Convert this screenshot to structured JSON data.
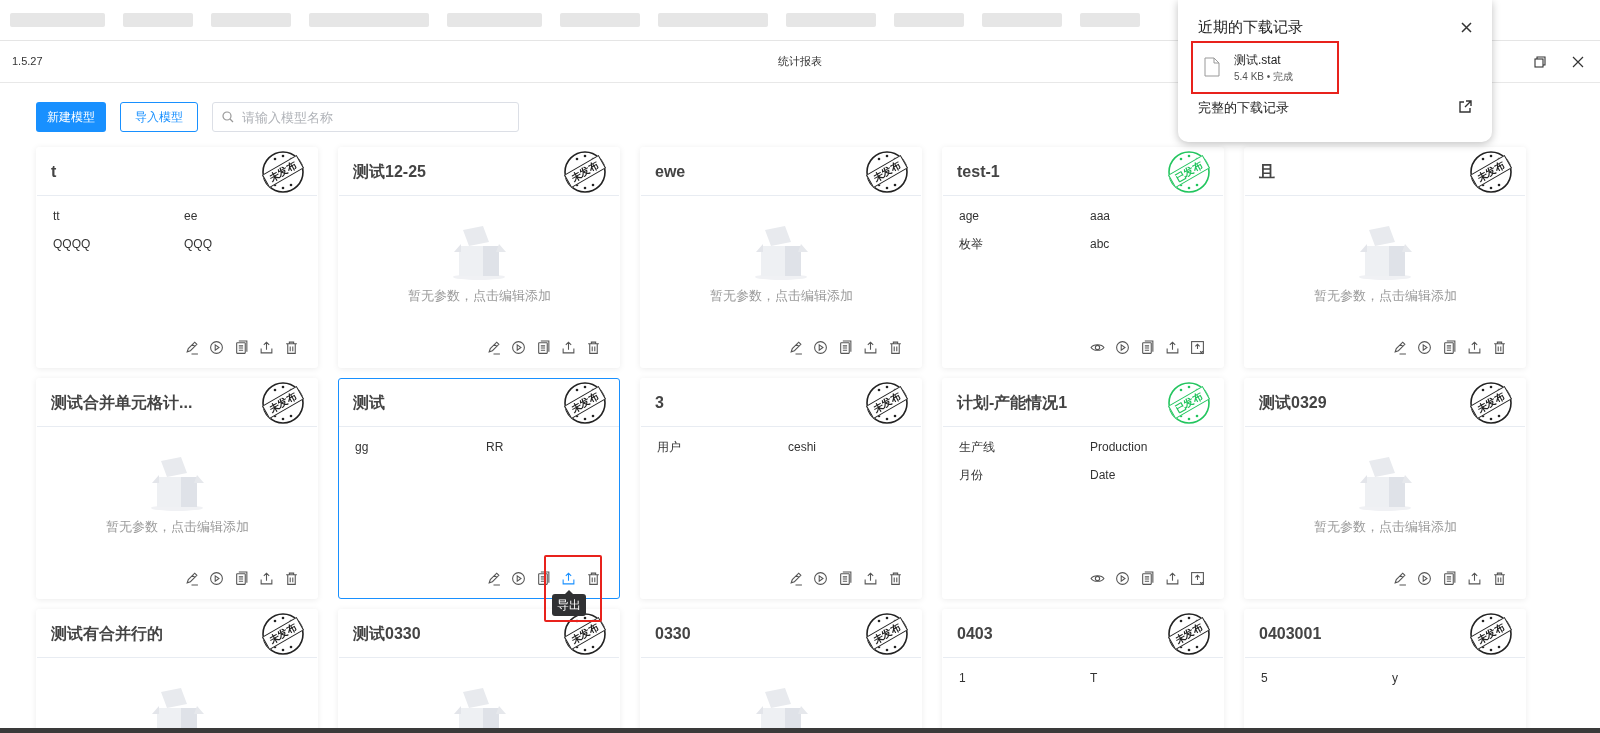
{
  "window": {
    "version": "1.5.27",
    "title": "统计报表"
  },
  "toolbar": {
    "buttons": [
      {
        "label": "新建模型",
        "kind": "primary"
      },
      {
        "label": "导入模型",
        "kind": "outline"
      }
    ],
    "search": {
      "placeholder": "请输入模型名称"
    }
  },
  "cards": [
    {
      "title": "t",
      "stamp": "未发布",
      "published": false,
      "selected": false,
      "params": [
        [
          "tt",
          "ee"
        ],
        [
          "QQQQ",
          "QQQ"
        ]
      ]
    },
    {
      "title": "测试12-25",
      "stamp": "未发布",
      "published": false,
      "selected": false,
      "empty_text": "暂无参数，点击编辑添加"
    },
    {
      "title": "ewe",
      "stamp": "未发布",
      "published": false,
      "selected": false,
      "empty_text": "暂无参数，点击编辑添加"
    },
    {
      "title": "test-1",
      "stamp": "已发布",
      "published": true,
      "selected": false,
      "params": [
        [
          "age",
          "aaa"
        ],
        [
          "枚举",
          "abc"
        ]
      ]
    },
    {
      "title": "且",
      "stamp": "未发布",
      "published": false,
      "selected": false,
      "empty_text": "暂无参数，点击编辑添加"
    },
    {
      "title": "测试合并单元格计...",
      "stamp": "未发布",
      "published": false,
      "selected": false,
      "empty_text": "暂无参数，点击编辑添加"
    },
    {
      "title": "测试",
      "stamp": "未发布",
      "published": false,
      "selected": true,
      "params": [
        [
          "gg",
          "RR"
        ]
      ],
      "tooltip": "导出"
    },
    {
      "title": "3",
      "stamp": "未发布",
      "published": false,
      "selected": false,
      "params": [
        [
          "用户",
          "ceshi"
        ]
      ]
    },
    {
      "title": "计划-产能情况1",
      "stamp": "已发布",
      "published": true,
      "selected": false,
      "params": [
        [
          "生产线",
          "Production"
        ],
        [
          "月份",
          "Date"
        ]
      ]
    },
    {
      "title": "测试0329",
      "stamp": "未发布",
      "published": false,
      "selected": false,
      "empty_text": "暂无参数，点击编辑添加"
    },
    {
      "title": "测试有合并行的",
      "stamp": "未发布",
      "published": false,
      "selected": false
    },
    {
      "title": "测试0330",
      "stamp": "未发布",
      "published": false,
      "selected": false
    },
    {
      "title": "0330",
      "stamp": "未发布",
      "published": false,
      "selected": false
    },
    {
      "title": "0403",
      "stamp": "未发布",
      "published": false,
      "selected": false,
      "params": [
        [
          "1",
          "T"
        ]
      ]
    },
    {
      "title": "0403001",
      "stamp": "未发布",
      "published": false,
      "selected": false,
      "params": [
        [
          "5",
          "y"
        ]
      ]
    }
  ],
  "downloads": {
    "title": "近期的下载记录",
    "items": [
      {
        "name": "测试.stat",
        "meta": "5.4 KB • 完成"
      }
    ],
    "link": "完整的下载记录"
  }
}
